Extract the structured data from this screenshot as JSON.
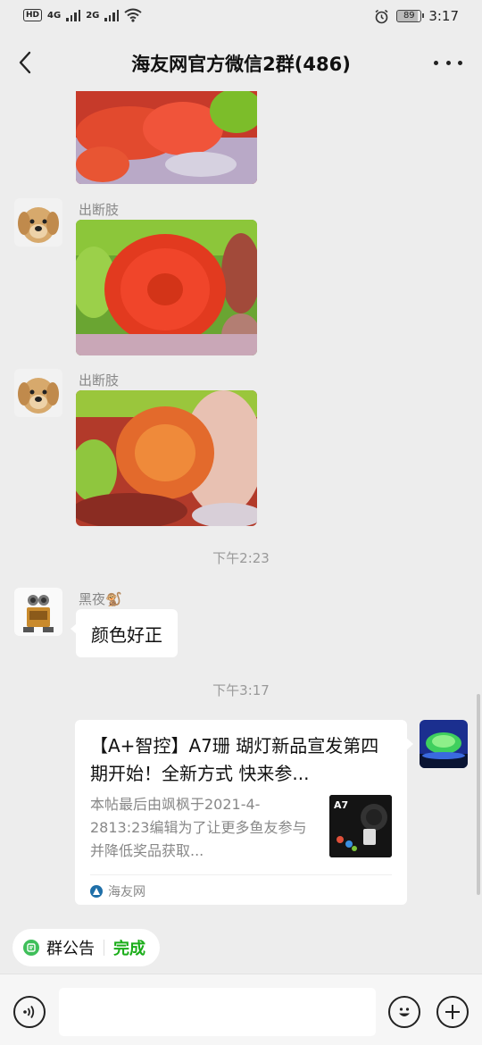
{
  "status_bar": {
    "hd_label": "HD",
    "network1": "4G",
    "network2": "2G",
    "battery": "89",
    "time": "3:17"
  },
  "header": {
    "title": "海友网官方微信2群(486)",
    "back_icon": "chevron-left-icon",
    "more_icon": "more-dots-icon"
  },
  "messages": [
    {
      "type": "image",
      "desc": "coral photo (cropped)"
    },
    {
      "type": "image",
      "sender": "出断肢",
      "avatar": "golden-retriever-avatar"
    },
    {
      "type": "image",
      "sender": "出断肢",
      "avatar": "golden-retriever-avatar"
    },
    {
      "type": "time",
      "text": "下午2:23"
    },
    {
      "type": "text",
      "sender": "黑夜🐒",
      "avatar": "robot-avatar",
      "text": "颜色好正"
    },
    {
      "type": "time",
      "text": "下午3:17"
    },
    {
      "type": "link_card",
      "title": "【A+智控】A7珊 瑚灯新品宣发第四期开始！全新方式  快来参...",
      "description": "本帖最后由飒枫于2021-4-2813:23编辑为了让更多鱼友参与并降低奖品获取...",
      "thumb_label": "A7",
      "source": "海友网"
    }
  ],
  "announcement": {
    "label": "群公告",
    "action": "完成"
  },
  "input_bar": {
    "voice_icon": "voice-icon",
    "emoji_icon": "emoji-icon",
    "plus_icon": "plus-icon",
    "placeholder": ""
  },
  "colors": {
    "background": "#ededed",
    "accent_green": "#1aad19",
    "bubble": "#ffffff"
  }
}
